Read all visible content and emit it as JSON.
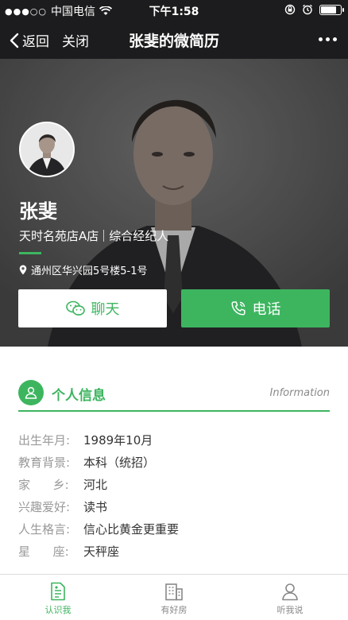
{
  "status": {
    "carrier": "中国电信",
    "time": "下午1:58",
    "battery_level": 0.8
  },
  "nav": {
    "back_label": "返回",
    "close_label": "关闭",
    "title": "张斐的微简历"
  },
  "profile": {
    "name": "张斐",
    "store": "天时名苑店A店",
    "position": "综合经纪人",
    "address": "通州区华兴园5号楼5-1号",
    "chat_label": "聊天",
    "call_label": "电话"
  },
  "section": {
    "title": "个人信息",
    "subtitle_en": "Information",
    "icon": "person-icon"
  },
  "info": [
    {
      "label": "出生年月:",
      "value": "1989年10月"
    },
    {
      "label": "教育背景:",
      "value": "本科（统招）"
    },
    {
      "label": "家      乡:",
      "value": "河北"
    },
    {
      "label": "兴趣爱好:",
      "value": "读书"
    },
    {
      "label": "人生格言:",
      "value": "信心比黄金更重要"
    },
    {
      "label": "星      座:",
      "value": "天秤座"
    }
  ],
  "tabs": [
    {
      "label": "认识我",
      "icon": "document-icon",
      "active": true
    },
    {
      "label": "有好房",
      "icon": "building-icon",
      "active": false
    },
    {
      "label": "听我说",
      "icon": "user-icon",
      "active": false
    }
  ],
  "colors": {
    "accent": "#3db55f",
    "dark_bar": "#1c1c1e"
  }
}
